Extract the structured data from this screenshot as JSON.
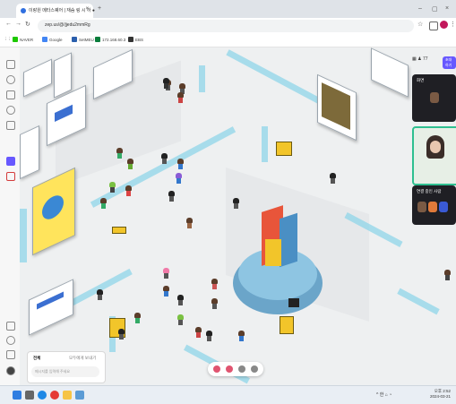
{
  "browser": {
    "tab_title": "이랑원 메타스퀘어 | 재슴 링 시 하 ●",
    "url": "zep.us/@/jjedu2mmRg",
    "bookmarks": [
      "NAVER",
      "Google",
      "SetMEU",
      "172.168.60.3",
      "EBS"
    ]
  },
  "chat": {
    "tab_all": "전체",
    "tab_other": "모두에게 보내기",
    "input_placeholder": "메시지를 입력해 주세요"
  },
  "right_panel": {
    "top_count": "77",
    "invite_label": "초대하기",
    "panel1_title": "화면",
    "panel2_title": "연결 중인 사람"
  },
  "colors": {
    "accent": "#6758ff",
    "wall": "#8fd6e8",
    "sign": "#f2c52a"
  },
  "taskbar": {
    "date": "2024-03-21",
    "time": "오후 2:52"
  }
}
